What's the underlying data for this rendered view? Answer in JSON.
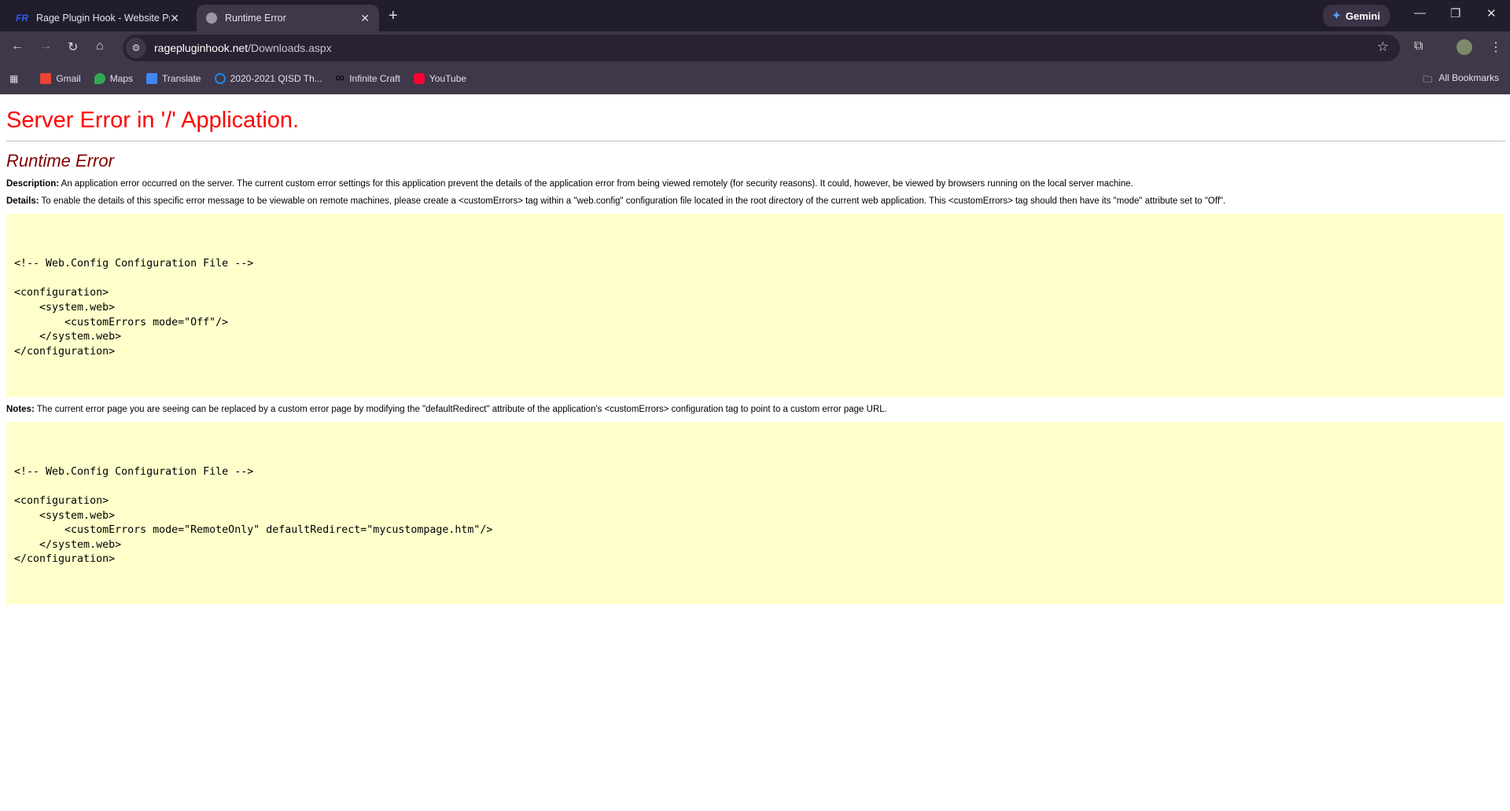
{
  "browser": {
    "tabs": [
      {
        "label": "Rage Plugin Hook - Website Pro",
        "favicon": "FR"
      },
      {
        "label": "Runtime Error"
      }
    ],
    "gemini_label": "Gemini",
    "url_host": "ragepluginhook.net",
    "url_path": "/Downloads.aspx",
    "bookmarks": [
      {
        "label": "Gmail",
        "color": "#ea4335"
      },
      {
        "label": "Maps",
        "color": "#34a853"
      },
      {
        "label": "Translate",
        "color": "#4285f4"
      },
      {
        "label": "2020-2021 QISD Th...",
        "color": "#1e88e5"
      },
      {
        "label": "Infinite Craft",
        "color": "#000000"
      },
      {
        "label": "YouTube",
        "color": "#ff0033"
      }
    ],
    "all_bookmarks": "All Bookmarks"
  },
  "page": {
    "title": "Server Error in '/' Application.",
    "subtitle": "Runtime Error",
    "description_label": "Description:",
    "description": " An application error occurred on the server. The current custom error settings for this application prevent the details of the application error from being viewed remotely (for security reasons). It could, however, be viewed by browsers running on the local server machine.",
    "details_label": "Details:",
    "details": " To enable the details of this specific error message to be viewable on remote machines, please create a <customErrors> tag within a \"web.config\" configuration file located in the root directory of the current web application. This <customErrors> tag should then have its \"mode\" attribute set to \"Off\".",
    "code1": [
      "<!-- Web.Config Configuration File -->",
      "",
      "<configuration>",
      "    <system.web>",
      "        <customErrors mode=\"Off\"/>",
      "    </system.web>",
      "</configuration>"
    ],
    "notes_label": "Notes:",
    "notes": " The current error page you are seeing can be replaced by a custom error page by modifying the \"defaultRedirect\" attribute of the application's <customErrors> configuration tag to point to a custom error page URL.",
    "code2": [
      "<!-- Web.Config Configuration File -->",
      "",
      "<configuration>",
      "    <system.web>",
      "        <customErrors mode=\"RemoteOnly\" defaultRedirect=\"mycustompage.htm\"/>",
      "    </system.web>",
      "</configuration>"
    ]
  }
}
